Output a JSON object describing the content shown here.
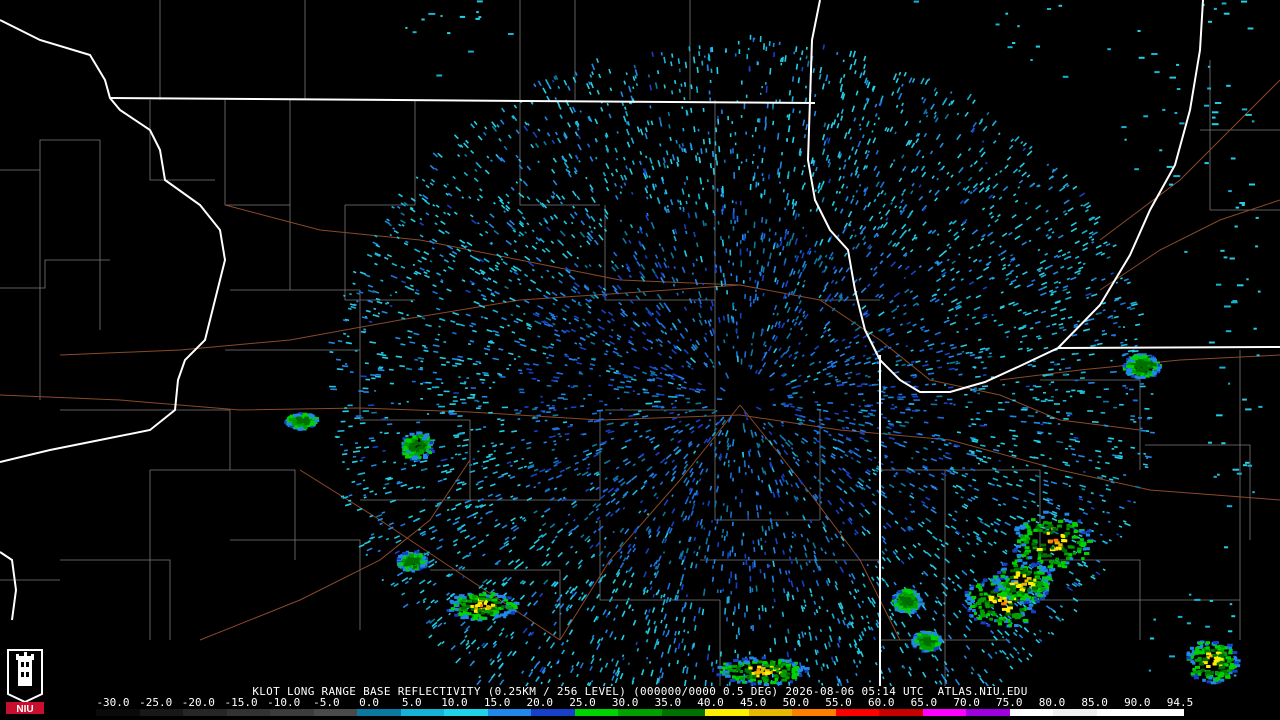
{
  "product": {
    "caption": "KLOT LONG RANGE BASE REFLECTIVITY (0.25KM / 256 LEVEL) (000000/0000 0.5 DEG) 2026-08-06 05:14 UTC  ATLAS.NIU.EDU"
  },
  "scale": {
    "labels": [
      "-30.0",
      "-25.0",
      "-20.0",
      "-15.0",
      "-10.0",
      "-5.0",
      "0.0",
      "5.0",
      "10.0",
      "15.0",
      "20.0",
      "25.0",
      "30.0",
      "35.0",
      "40.0",
      "45.0",
      "50.0",
      "55.0",
      "60.0",
      "65.0",
      "70.0",
      "75.0",
      "80.0",
      "85.0",
      "90.0",
      "94.5"
    ],
    "colors": [
      "#0a0a0a",
      "#181818",
      "#262626",
      "#323232",
      "#3c3c3c",
      "#4a4a4a",
      "#0b7a9e",
      "#17b3d6",
      "#1fd3e8",
      "#2187e8",
      "#1640c8",
      "#00d400",
      "#00a000",
      "#007000",
      "#fff000",
      "#e8b800",
      "#ff8000",
      "#ff0000",
      "#c80000",
      "#ff00ff",
      "#a000e0",
      "#ffffff",
      "#f0f0f0",
      "#ffffff",
      "#ffffff"
    ]
  },
  "logo": {
    "text": "NIU",
    "color": "#c8102e"
  }
}
